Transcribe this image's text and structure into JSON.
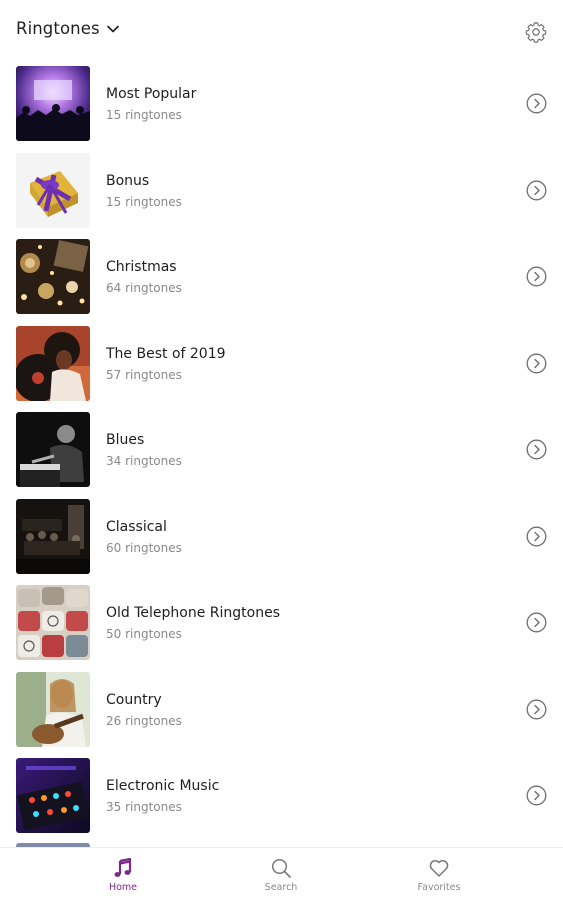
{
  "header": {
    "title": "Ringtones",
    "title_icon": "chevron-down-icon",
    "settings_icon": "gear-icon"
  },
  "categories": [
    {
      "title": "Most Popular",
      "count": "15 ringtones",
      "image": "concert-crowd-purple-lights"
    },
    {
      "title": "Bonus",
      "count": "15 ringtones",
      "image": "gift-box-purple-ribbon"
    },
    {
      "title": "Christmas",
      "count": "64 ringtones",
      "image": "christmas-decorations-gold"
    },
    {
      "title": "The Best of 2019",
      "count": "57 ringtones",
      "image": "woman-with-vinyl-record"
    },
    {
      "title": "Blues",
      "count": "34 ringtones",
      "image": "pianist-black-and-white"
    },
    {
      "title": "Classical",
      "count": "60 ringtones",
      "image": "orchestra-on-stage"
    },
    {
      "title": "Old Telephone Ringtones",
      "count": "50 ringtones",
      "image": "vintage-telephones"
    },
    {
      "title": "Country",
      "count": "26 ringtones",
      "image": "woman-playing-guitar"
    },
    {
      "title": "Electronic Music",
      "count": "35 ringtones",
      "image": "dj-mixer-lights"
    }
  ],
  "nav": {
    "home": {
      "label": "Home",
      "icon": "music-note-icon"
    },
    "search": {
      "label": "Search",
      "icon": "search-icon"
    },
    "favorites": {
      "label": "Favorites",
      "icon": "heart-icon"
    }
  },
  "colors": {
    "accent": "#7a2a86",
    "muted": "#8a8a8a",
    "text": "#1e1e1e"
  }
}
